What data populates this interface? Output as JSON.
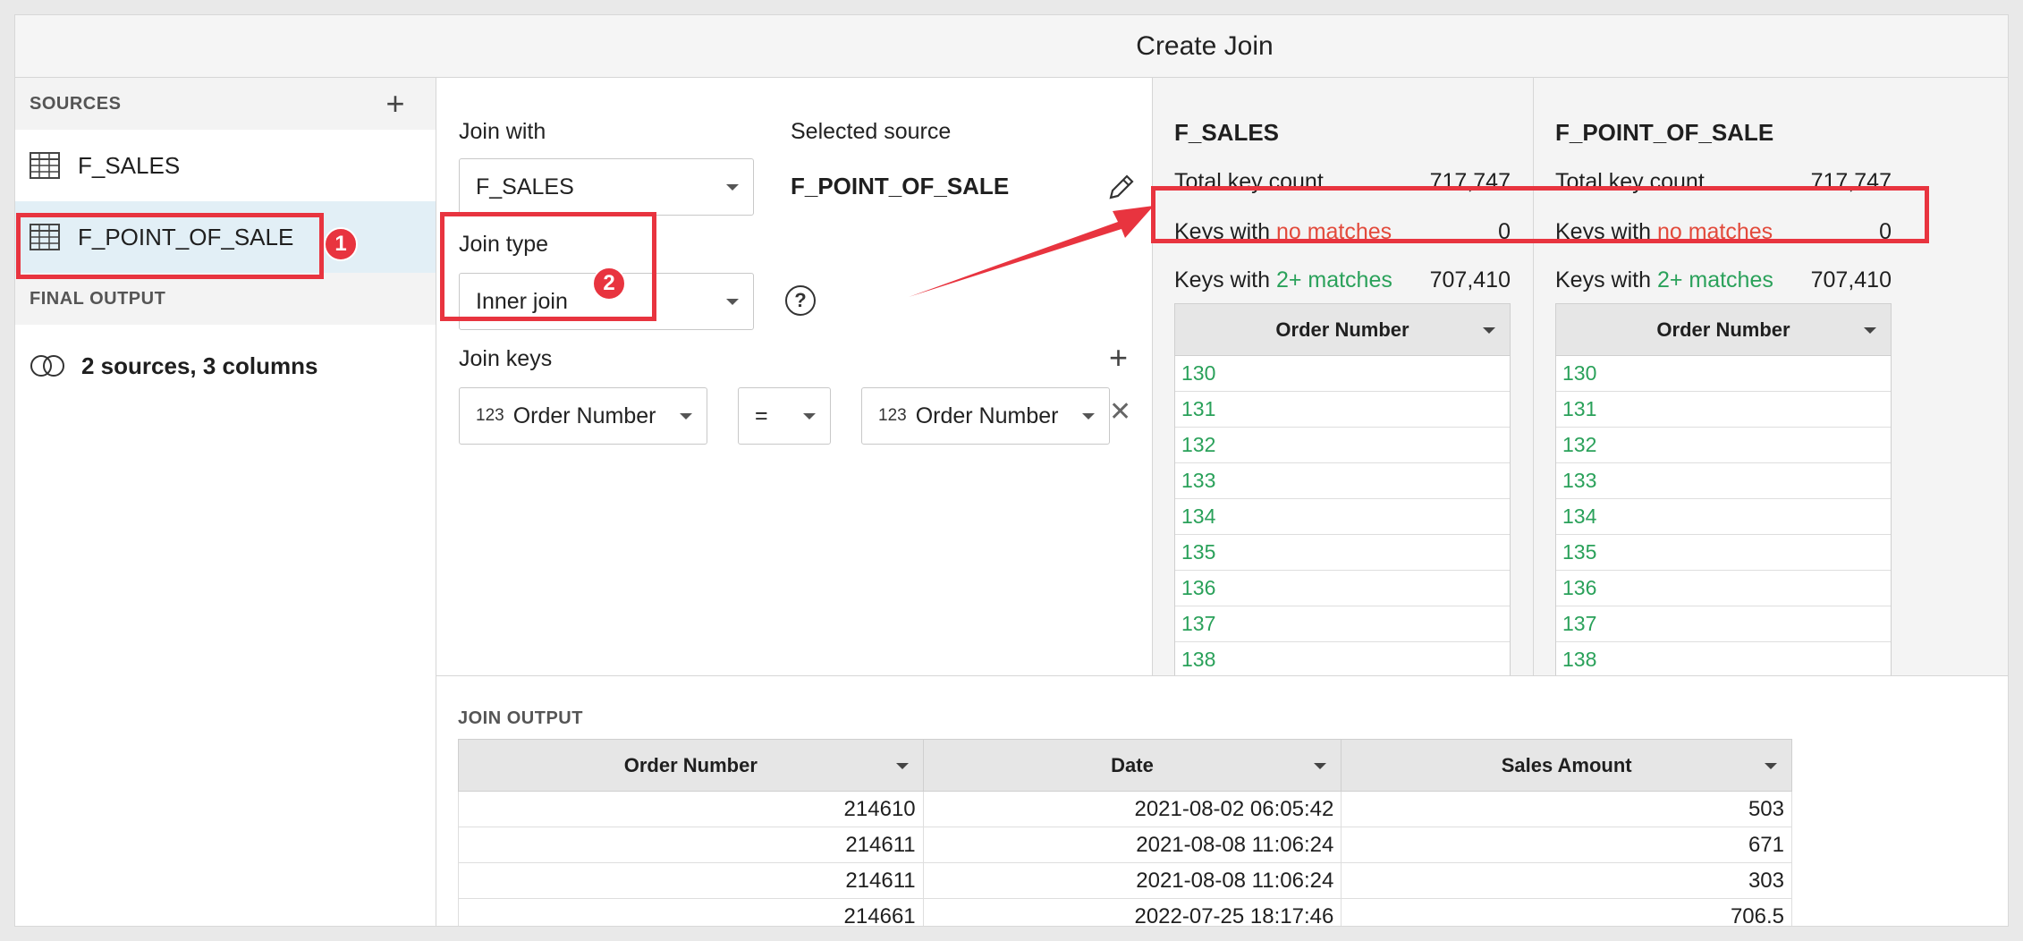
{
  "window": {
    "title": "Create Join"
  },
  "sidebar": {
    "sources_header": "SOURCES",
    "sources": [
      {
        "label": "F_SALES",
        "icon": "table-icon"
      },
      {
        "label": "F_POINT_OF_SALE",
        "icon": "table-icon",
        "selected": true
      }
    ],
    "final_header": "FINAL OUTPUT",
    "final_item": "2 sources, 3 columns"
  },
  "config": {
    "join_with_label": "Join with",
    "join_with_value": "F_SALES",
    "selected_source_label": "Selected source",
    "selected_source_value": "F_POINT_OF_SALE",
    "join_type_label": "Join type",
    "join_type_value": "Inner join",
    "join_keys_label": "Join keys",
    "key_left_type": "123",
    "key_left_value": "Order Number",
    "operator": "=",
    "key_right_type": "123",
    "key_right_value": "Order Number"
  },
  "stats": [
    {
      "name": "F_SALES",
      "total_label": "Total key count",
      "total_value": "717,747",
      "no_match_prefix": "Keys with ",
      "no_match_label": "no matches",
      "no_match_value": "0",
      "multi_prefix": "Keys with ",
      "multi_label": "2+ matches",
      "multi_value": "707,410",
      "column_header": "Order Number",
      "keys": [
        "130",
        "131",
        "132",
        "133",
        "134",
        "135",
        "136",
        "137",
        "138"
      ]
    },
    {
      "name": "F_POINT_OF_SALE",
      "total_label": "Total key count",
      "total_value": "717,747",
      "no_match_prefix": "Keys with ",
      "no_match_label": "no matches",
      "no_match_value": "0",
      "multi_prefix": "Keys with ",
      "multi_label": "2+ matches",
      "multi_value": "707,410",
      "column_header": "Order Number",
      "keys": [
        "130",
        "131",
        "132",
        "133",
        "134",
        "135",
        "136",
        "137",
        "138"
      ]
    }
  ],
  "output": {
    "header": "JOIN OUTPUT",
    "columns": [
      "Order Number",
      "Date",
      "Sales Amount"
    ],
    "rows": [
      [
        "214610",
        "2021-08-02 06:05:42",
        "503"
      ],
      [
        "214611",
        "2021-08-08 11:06:24",
        "671"
      ],
      [
        "214611",
        "2021-08-08 11:06:24",
        "303"
      ],
      [
        "214661",
        "2022-07-25 18:17:46",
        "706.5"
      ]
    ]
  },
  "annotations": {
    "badge1": "1",
    "badge2": "2"
  },
  "colors": {
    "accent_red": "#e8343f",
    "match_green": "#2aa15a",
    "no_match_red": "#e24a3b",
    "selected_bg": "#e2eff6"
  }
}
